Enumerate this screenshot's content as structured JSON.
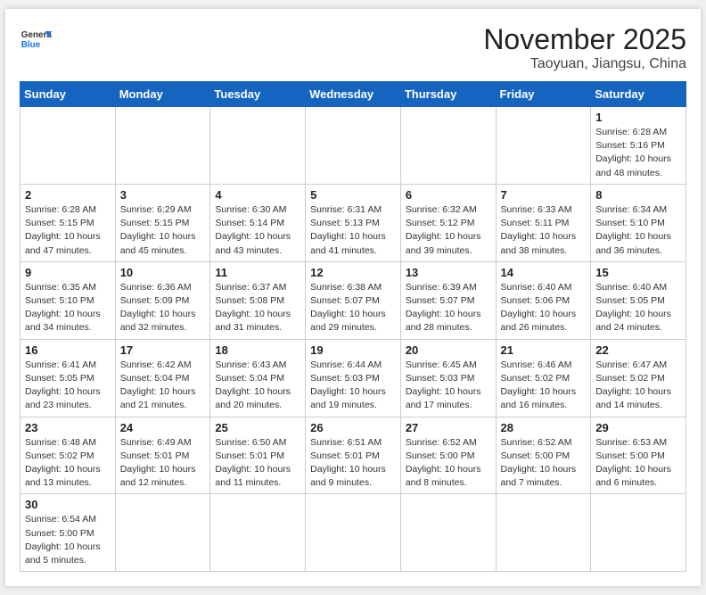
{
  "header": {
    "logo_general": "General",
    "logo_blue": "Blue",
    "month": "November 2025",
    "location": "Taoyuan, Jiangsu, China"
  },
  "weekdays": [
    "Sunday",
    "Monday",
    "Tuesday",
    "Wednesday",
    "Thursday",
    "Friday",
    "Saturday"
  ],
  "weeks": [
    [
      {
        "day": "",
        "info": ""
      },
      {
        "day": "",
        "info": ""
      },
      {
        "day": "",
        "info": ""
      },
      {
        "day": "",
        "info": ""
      },
      {
        "day": "",
        "info": ""
      },
      {
        "day": "",
        "info": ""
      },
      {
        "day": "1",
        "info": "Sunrise: 6:28 AM\nSunset: 5:16 PM\nDaylight: 10 hours\nand 48 minutes."
      }
    ],
    [
      {
        "day": "2",
        "info": "Sunrise: 6:28 AM\nSunset: 5:15 PM\nDaylight: 10 hours\nand 47 minutes."
      },
      {
        "day": "3",
        "info": "Sunrise: 6:29 AM\nSunset: 5:15 PM\nDaylight: 10 hours\nand 45 minutes."
      },
      {
        "day": "4",
        "info": "Sunrise: 6:30 AM\nSunset: 5:14 PM\nDaylight: 10 hours\nand 43 minutes."
      },
      {
        "day": "5",
        "info": "Sunrise: 6:31 AM\nSunset: 5:13 PM\nDaylight: 10 hours\nand 41 minutes."
      },
      {
        "day": "6",
        "info": "Sunrise: 6:32 AM\nSunset: 5:12 PM\nDaylight: 10 hours\nand 39 minutes."
      },
      {
        "day": "7",
        "info": "Sunrise: 6:33 AM\nSunset: 5:11 PM\nDaylight: 10 hours\nand 38 minutes."
      },
      {
        "day": "8",
        "info": "Sunrise: 6:34 AM\nSunset: 5:10 PM\nDaylight: 10 hours\nand 36 minutes."
      }
    ],
    [
      {
        "day": "9",
        "info": "Sunrise: 6:35 AM\nSunset: 5:10 PM\nDaylight: 10 hours\nand 34 minutes."
      },
      {
        "day": "10",
        "info": "Sunrise: 6:36 AM\nSunset: 5:09 PM\nDaylight: 10 hours\nand 32 minutes."
      },
      {
        "day": "11",
        "info": "Sunrise: 6:37 AM\nSunset: 5:08 PM\nDaylight: 10 hours\nand 31 minutes."
      },
      {
        "day": "12",
        "info": "Sunrise: 6:38 AM\nSunset: 5:07 PM\nDaylight: 10 hours\nand 29 minutes."
      },
      {
        "day": "13",
        "info": "Sunrise: 6:39 AM\nSunset: 5:07 PM\nDaylight: 10 hours\nand 28 minutes."
      },
      {
        "day": "14",
        "info": "Sunrise: 6:40 AM\nSunset: 5:06 PM\nDaylight: 10 hours\nand 26 minutes."
      },
      {
        "day": "15",
        "info": "Sunrise: 6:40 AM\nSunset: 5:05 PM\nDaylight: 10 hours\nand 24 minutes."
      }
    ],
    [
      {
        "day": "16",
        "info": "Sunrise: 6:41 AM\nSunset: 5:05 PM\nDaylight: 10 hours\nand 23 minutes."
      },
      {
        "day": "17",
        "info": "Sunrise: 6:42 AM\nSunset: 5:04 PM\nDaylight: 10 hours\nand 21 minutes."
      },
      {
        "day": "18",
        "info": "Sunrise: 6:43 AM\nSunset: 5:04 PM\nDaylight: 10 hours\nand 20 minutes."
      },
      {
        "day": "19",
        "info": "Sunrise: 6:44 AM\nSunset: 5:03 PM\nDaylight: 10 hours\nand 19 minutes."
      },
      {
        "day": "20",
        "info": "Sunrise: 6:45 AM\nSunset: 5:03 PM\nDaylight: 10 hours\nand 17 minutes."
      },
      {
        "day": "21",
        "info": "Sunrise: 6:46 AM\nSunset: 5:02 PM\nDaylight: 10 hours\nand 16 minutes."
      },
      {
        "day": "22",
        "info": "Sunrise: 6:47 AM\nSunset: 5:02 PM\nDaylight: 10 hours\nand 14 minutes."
      }
    ],
    [
      {
        "day": "23",
        "info": "Sunrise: 6:48 AM\nSunset: 5:02 PM\nDaylight: 10 hours\nand 13 minutes."
      },
      {
        "day": "24",
        "info": "Sunrise: 6:49 AM\nSunset: 5:01 PM\nDaylight: 10 hours\nand 12 minutes."
      },
      {
        "day": "25",
        "info": "Sunrise: 6:50 AM\nSunset: 5:01 PM\nDaylight: 10 hours\nand 11 minutes."
      },
      {
        "day": "26",
        "info": "Sunrise: 6:51 AM\nSunset: 5:01 PM\nDaylight: 10 hours\nand 9 minutes."
      },
      {
        "day": "27",
        "info": "Sunrise: 6:52 AM\nSunset: 5:00 PM\nDaylight: 10 hours\nand 8 minutes."
      },
      {
        "day": "28",
        "info": "Sunrise: 6:52 AM\nSunset: 5:00 PM\nDaylight: 10 hours\nand 7 minutes."
      },
      {
        "day": "29",
        "info": "Sunrise: 6:53 AM\nSunset: 5:00 PM\nDaylight: 10 hours\nand 6 minutes."
      }
    ],
    [
      {
        "day": "30",
        "info": "Sunrise: 6:54 AM\nSunset: 5:00 PM\nDaylight: 10 hours\nand 5 minutes."
      },
      {
        "day": "",
        "info": ""
      },
      {
        "day": "",
        "info": ""
      },
      {
        "day": "",
        "info": ""
      },
      {
        "day": "",
        "info": ""
      },
      {
        "day": "",
        "info": ""
      },
      {
        "day": "",
        "info": ""
      }
    ]
  ]
}
